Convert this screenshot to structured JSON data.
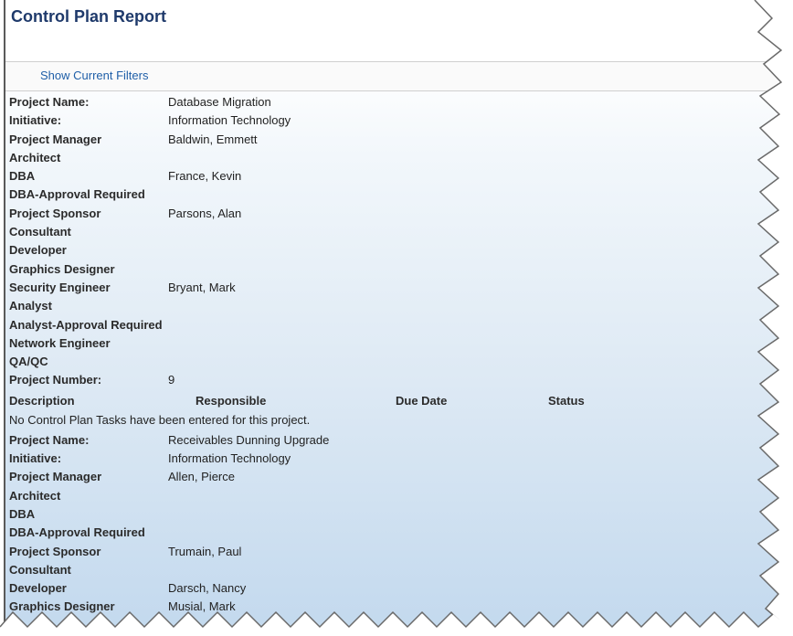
{
  "report": {
    "title": "Control Plan Report",
    "filter_link": "Show Current Filters"
  },
  "projects": [
    {
      "fields": [
        {
          "label": "Project Name:",
          "value": "Database Migration"
        },
        {
          "label": "Initiative:",
          "value": "Information Technology"
        },
        {
          "label": "Project Manager",
          "value": "Baldwin, Emmett"
        },
        {
          "label": "Architect",
          "value": ""
        },
        {
          "label": "DBA",
          "value": "France, Kevin"
        },
        {
          "label": "DBA-Approval Required",
          "value": ""
        },
        {
          "label": "Project Sponsor",
          "value": "Parsons, Alan"
        },
        {
          "label": "Consultant",
          "value": ""
        },
        {
          "label": "Developer",
          "value": ""
        },
        {
          "label": "Graphics Designer",
          "value": ""
        },
        {
          "label": "Security Engineer",
          "value": "Bryant, Mark"
        },
        {
          "label": "Analyst",
          "value": ""
        },
        {
          "label": "Analyst-Approval Required",
          "value": ""
        },
        {
          "label": "Network Engineer",
          "value": ""
        },
        {
          "label": "QA/QC",
          "value": ""
        },
        {
          "label": "Project Number:",
          "value": "9"
        }
      ],
      "tasks_header": {
        "description": "Description",
        "responsible": "Responsible",
        "due_date": "Due Date",
        "status": "Status"
      },
      "no_tasks_message": "No Control Plan Tasks have been entered for this project."
    },
    {
      "fields": [
        {
          "label": "Project Name:",
          "value": "Receivables Dunning Upgrade"
        },
        {
          "label": "Initiative:",
          "value": "Information Technology"
        },
        {
          "label": "Project Manager",
          "value": "Allen, Pierce"
        },
        {
          "label": "Architect",
          "value": ""
        },
        {
          "label": "DBA",
          "value": ""
        },
        {
          "label": "DBA-Approval Required",
          "value": ""
        },
        {
          "label": "Project Sponsor",
          "value": "Trumain, Paul"
        },
        {
          "label": "Consultant",
          "value": ""
        },
        {
          "label": "Developer",
          "value": "Darsch, Nancy"
        },
        {
          "label": "Graphics Designer",
          "value": "Musial, Mark"
        }
      ]
    }
  ]
}
